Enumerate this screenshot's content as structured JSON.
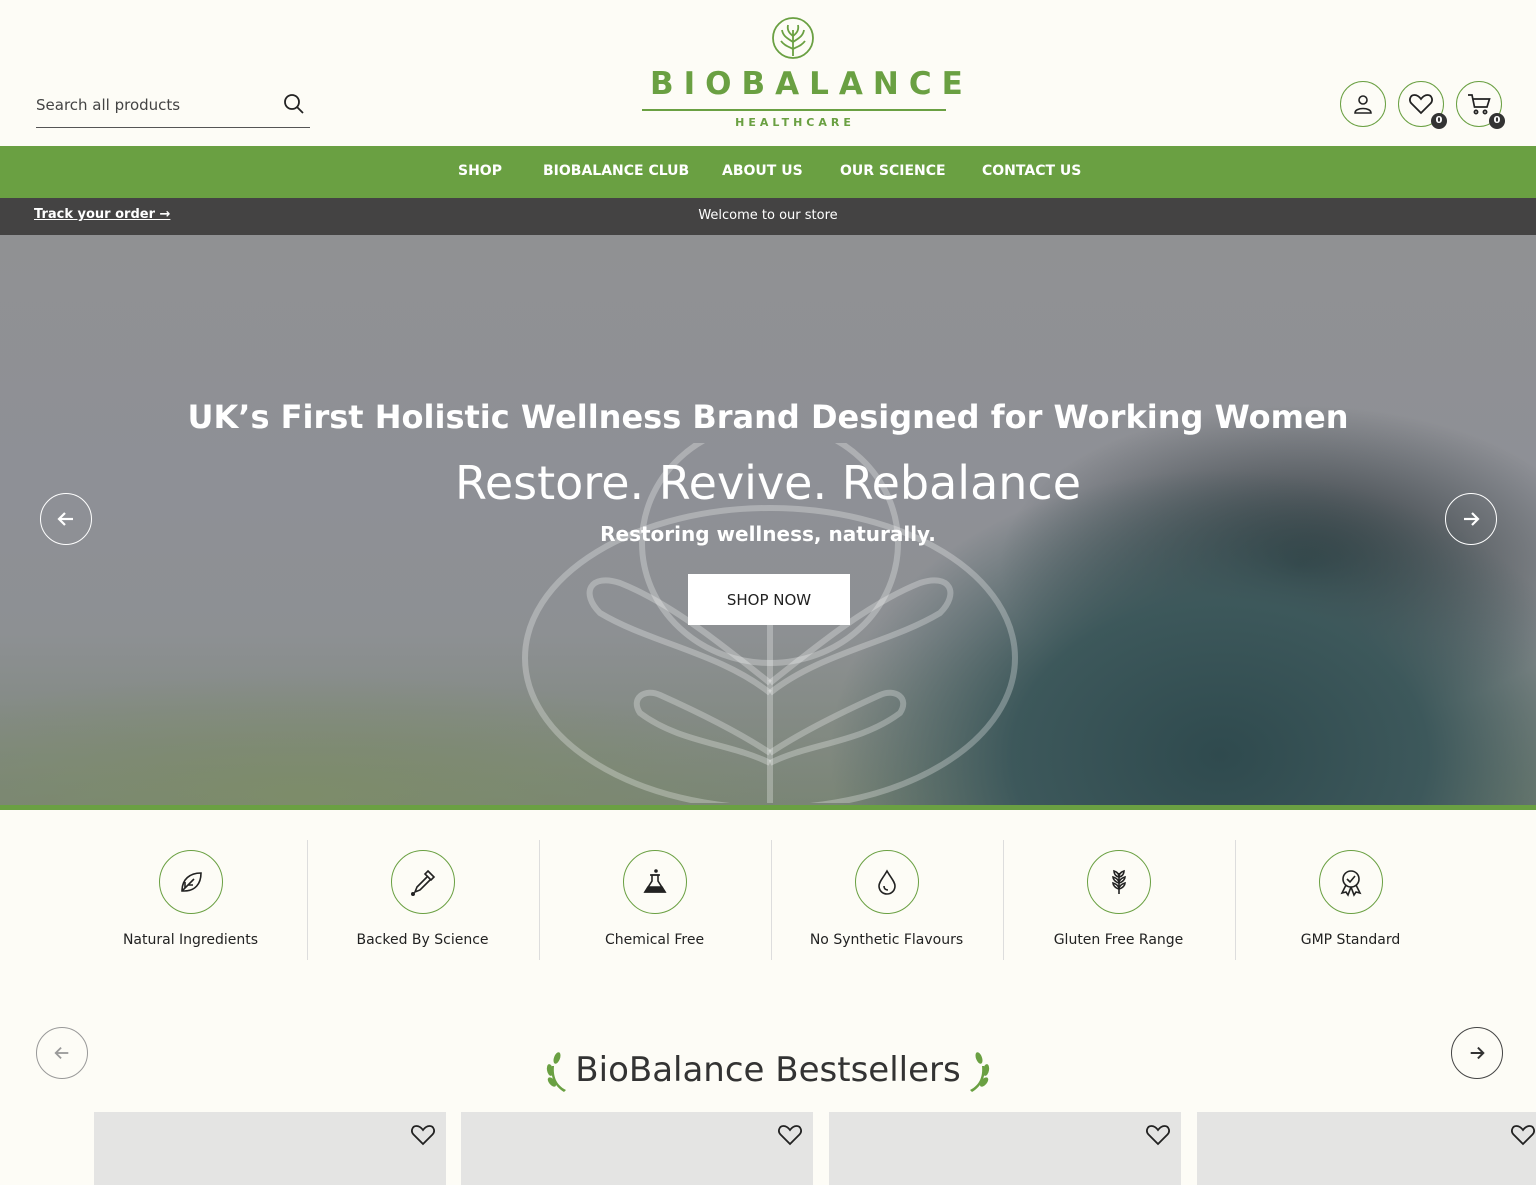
{
  "search": {
    "placeholder": "Search all products"
  },
  "brand": {
    "name": "BIOBALANCE",
    "subtitle": "HEALTHCARE",
    "color": "#6aa042"
  },
  "header_icons": [
    {
      "name": "account-icon"
    },
    {
      "name": "wishlist-icon",
      "count": "0"
    },
    {
      "name": "cart-icon",
      "count": "0"
    }
  ],
  "nav": {
    "items": [
      "SHOP",
      "BIOBALANCE CLUB",
      "ABOUT US",
      "OUR SCIENCE",
      "CONTACT US"
    ],
    "color": "#6aa042"
  },
  "infobar": {
    "track": "Track your order →",
    "welcome": "Welcome to our store",
    "color": "#444343"
  },
  "hero": {
    "heading": "UK’s First Holistic Wellness Brand Designed for Working Women",
    "title": "Restore. Revive. Rebalance",
    "tagline": "Restoring wellness, naturally.",
    "cta": "SHOP NOW"
  },
  "features": [
    {
      "label": "Natural Ingredients",
      "icon": "leaf-icon"
    },
    {
      "label": "Backed By Science",
      "icon": "dropper-icon"
    },
    {
      "label": "Chemical Free",
      "icon": "flask-icon"
    },
    {
      "label": "No Synthetic Flavours",
      "icon": "drop-icon"
    },
    {
      "label": "Gluten Free Range",
      "icon": "wheat-icon"
    },
    {
      "label": "GMP Standard",
      "icon": "award-icon"
    }
  ],
  "bestsellers": {
    "title": "BioBalance Bestsellers"
  }
}
